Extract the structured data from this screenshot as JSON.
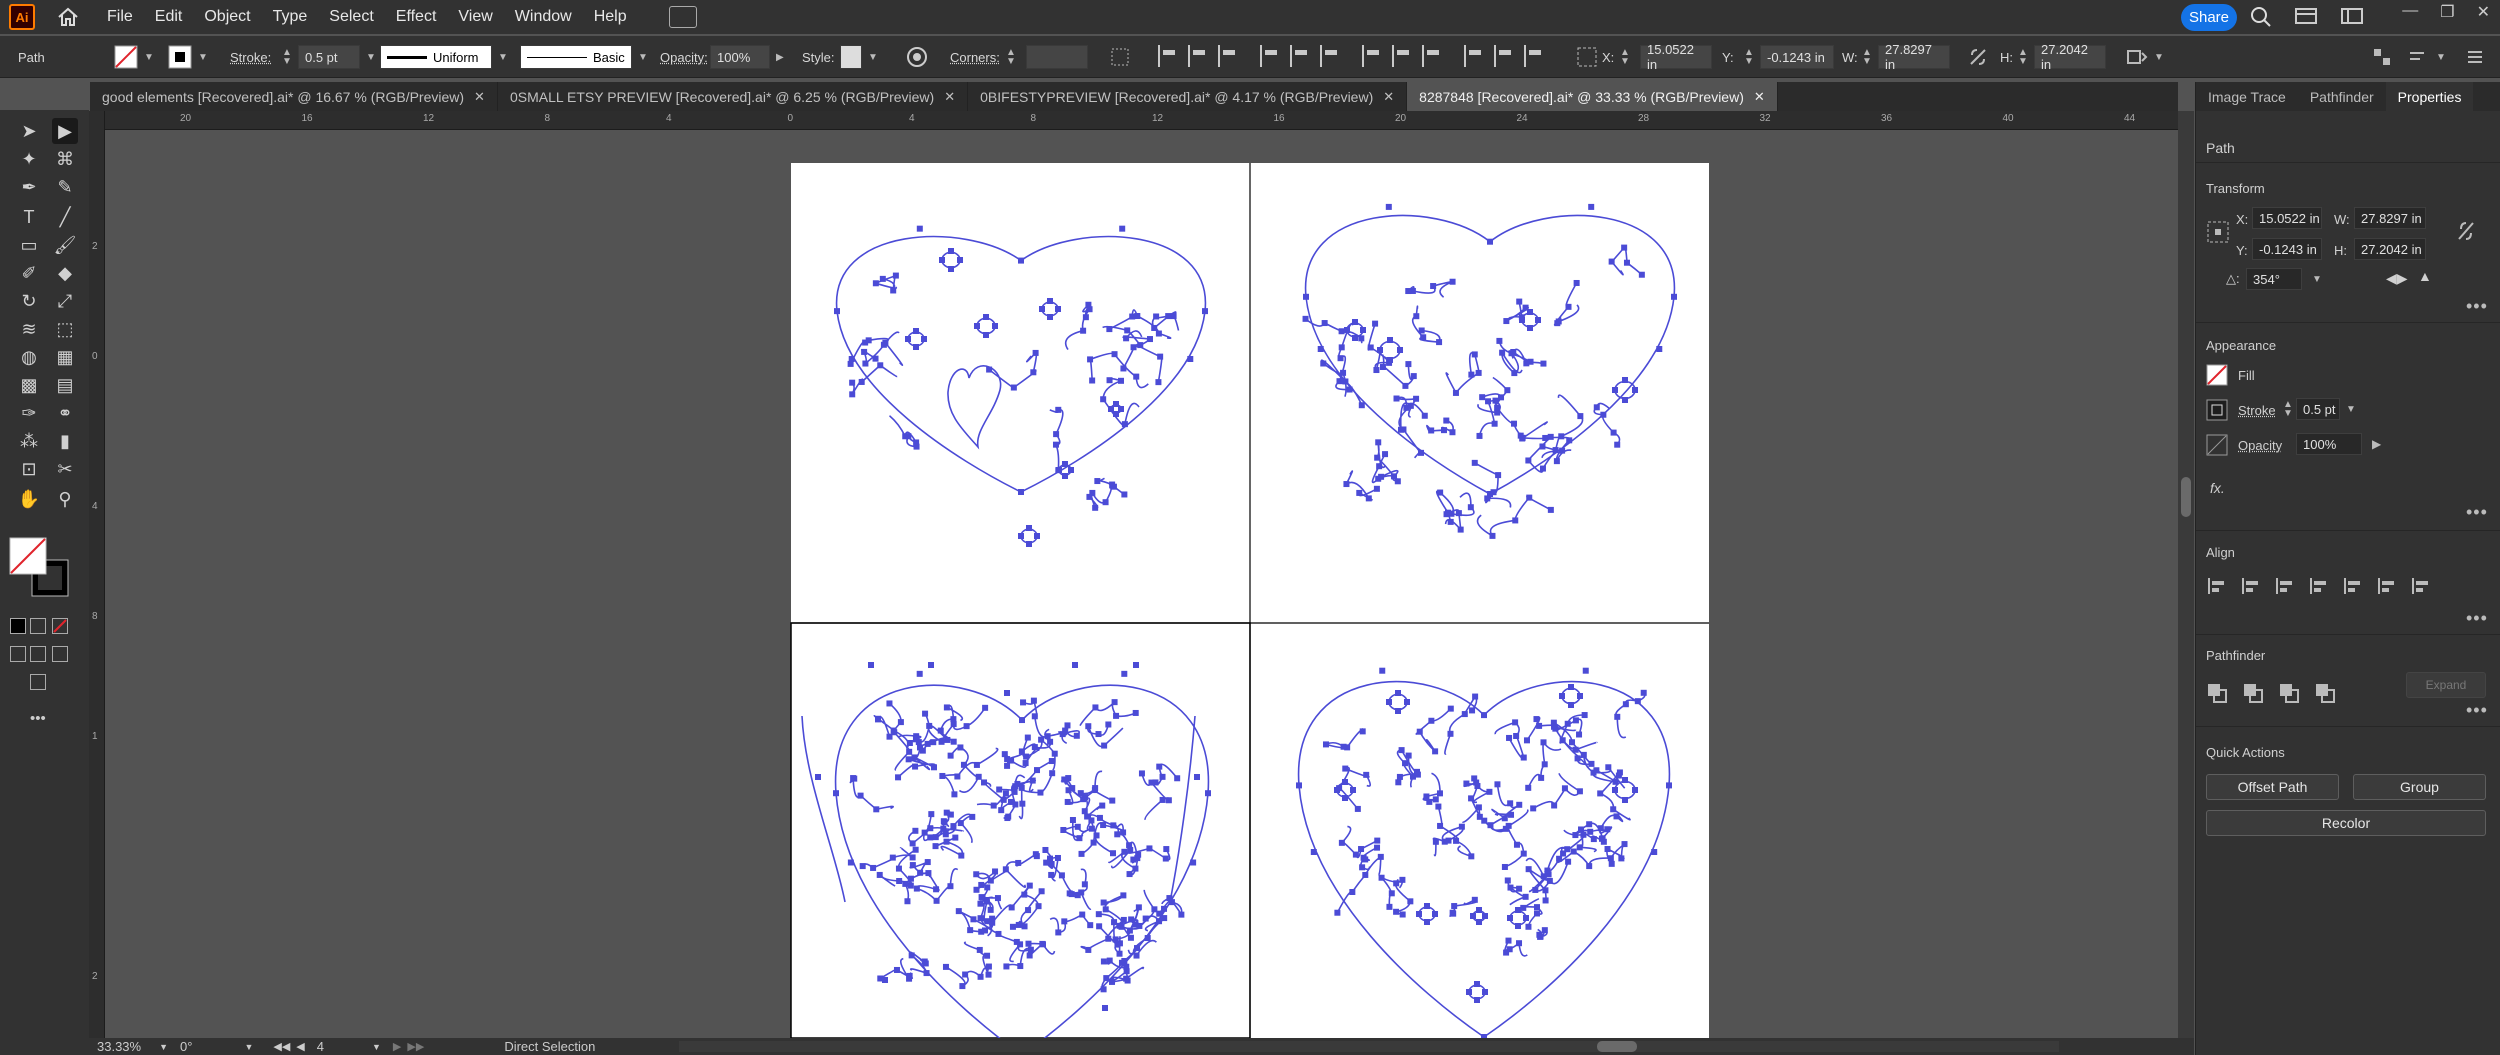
{
  "app": {
    "logo": "Ai"
  },
  "menu": [
    "File",
    "Edit",
    "Object",
    "Type",
    "Select",
    "Effect",
    "View",
    "Window",
    "Help"
  ],
  "share_label": "Share",
  "control": {
    "selection": "Path",
    "stroke_label": "Stroke:",
    "stroke_value": "0.5 pt",
    "stroke_style": "Uniform",
    "brush_style": "Basic",
    "opacity_label": "Opacity:",
    "opacity_value": "100%",
    "style_label": "Style:",
    "corners_label": "Corners:",
    "x_label": "X:",
    "x_value": "15.0522 in",
    "y_label": "Y:",
    "y_value": "-0.1243 in",
    "w_label": "W:",
    "w_value": "27.8297 in",
    "h_label": "H:",
    "h_value": "27.2042 in"
  },
  "tabs": [
    {
      "label": "good elements [Recovered].ai* @ 16.67 % (RGB/Preview)"
    },
    {
      "label": "0SMALL ETSY PREVIEW [Recovered].ai* @ 6.25 % (RGB/Preview)"
    },
    {
      "label": "0BIFESTYPREVIEW [Recovered].ai* @ 4.17 % (RGB/Preview)"
    },
    {
      "label": "8287848 [Recovered].ai* @ 33.33 % (RGB/Preview)"
    }
  ],
  "ruler_h": [
    "20",
    "16",
    "12",
    "8",
    "4",
    "0",
    "4",
    "8",
    "12",
    "16",
    "20",
    "24",
    "28",
    "32",
    "36",
    "40",
    "44"
  ],
  "ruler_v": [
    "2",
    "0",
    "4",
    "8",
    "1",
    "2"
  ],
  "status": {
    "zoom": "33.33%",
    "rotate": "0°",
    "artboard": "4",
    "tool": "Direct Selection"
  },
  "panel": {
    "tabs": [
      "Image Trace",
      "Pathfinder",
      "Properties"
    ],
    "selection": "Path",
    "transform_title": "Transform",
    "x_label": "X:",
    "x_value": "15.0522 in",
    "y_label": "Y:",
    "y_value": "-0.1243 in",
    "w_label": "W:",
    "w_value": "27.8297 in",
    "h_label": "H:",
    "h_value": "27.2042 in",
    "angle_value": "354°",
    "appearance_title": "Appearance",
    "fill_label": "Fill",
    "stroke_label": "Stroke",
    "stroke_value": "0.5 pt",
    "opacity_label": "Opacity",
    "opacity_value": "100%",
    "fx_label": "fx.",
    "align_title": "Align",
    "pathfinder_title": "Pathfinder",
    "expand_label": "Expand",
    "quick_actions_title": "Quick Actions",
    "offset_path_label": "Offset Path",
    "group_label": "Group",
    "recolor_label": "Recolor"
  },
  "colors": {
    "accent": "#1473e6",
    "path": "#4b4bd6",
    "ui_dark": "#323232",
    "canvas": "#535353"
  }
}
